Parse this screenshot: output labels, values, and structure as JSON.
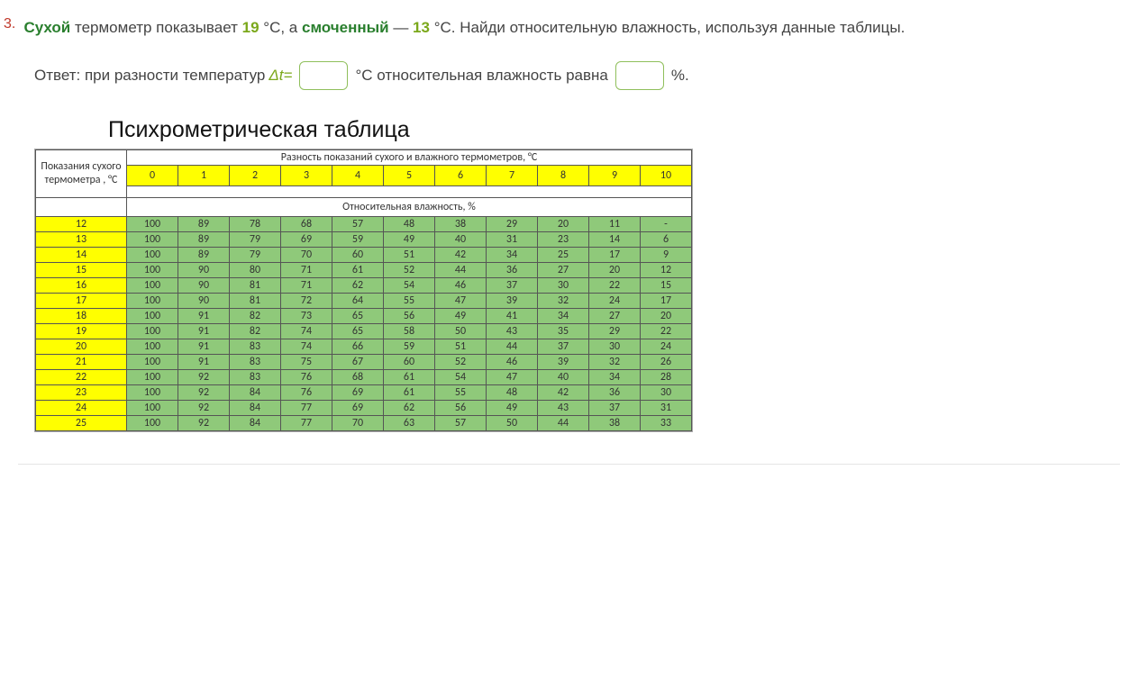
{
  "question": {
    "number": "3.",
    "t1": "Сухой",
    "t2": " термометр показывает ",
    "v1": "19",
    "t3": " °C, а ",
    "t4": "смоченный",
    "t5": " — ",
    "v2": "13",
    "t6": " °C. Найди относительную влажность, используя данные таблицы."
  },
  "answer": {
    "label1": "Ответ: при разности температур ",
    "delta": "Δt=",
    "label2": " °C относительная влажность равна ",
    "label3": " %."
  },
  "table": {
    "title": "Психрометрическая таблица",
    "left_header": "Показания сухого термометра , °C",
    "top_header": "Разность показаний сухого и влажного термометров, °C",
    "sub_header": "Относительная влажность, %",
    "cols": [
      "0",
      "1",
      "2",
      "3",
      "4",
      "5",
      "6",
      "7",
      "8",
      "9",
      "10"
    ],
    "rows": [
      {
        "t": "12",
        "v": [
          "100",
          "89",
          "78",
          "68",
          "57",
          "48",
          "38",
          "29",
          "20",
          "11",
          "-"
        ]
      },
      {
        "t": "13",
        "v": [
          "100",
          "89",
          "79",
          "69",
          "59",
          "49",
          "40",
          "31",
          "23",
          "14",
          "6"
        ]
      },
      {
        "t": "14",
        "v": [
          "100",
          "89",
          "79",
          "70",
          "60",
          "51",
          "42",
          "34",
          "25",
          "17",
          "9"
        ]
      },
      {
        "t": "15",
        "v": [
          "100",
          "90",
          "80",
          "71",
          "61",
          "52",
          "44",
          "36",
          "27",
          "20",
          "12"
        ]
      },
      {
        "t": "16",
        "v": [
          "100",
          "90",
          "81",
          "71",
          "62",
          "54",
          "46",
          "37",
          "30",
          "22",
          "15"
        ]
      },
      {
        "t": "17",
        "v": [
          "100",
          "90",
          "81",
          "72",
          "64",
          "55",
          "47",
          "39",
          "32",
          "24",
          "17"
        ]
      },
      {
        "t": "18",
        "v": [
          "100",
          "91",
          "82",
          "73",
          "65",
          "56",
          "49",
          "41",
          "34",
          "27",
          "20"
        ]
      },
      {
        "t": "19",
        "v": [
          "100",
          "91",
          "82",
          "74",
          "65",
          "58",
          "50",
          "43",
          "35",
          "29",
          "22"
        ]
      },
      {
        "t": "20",
        "v": [
          "100",
          "91",
          "83",
          "74",
          "66",
          "59",
          "51",
          "44",
          "37",
          "30",
          "24"
        ]
      },
      {
        "t": "21",
        "v": [
          "100",
          "91",
          "83",
          "75",
          "67",
          "60",
          "52",
          "46",
          "39",
          "32",
          "26"
        ]
      },
      {
        "t": "22",
        "v": [
          "100",
          "92",
          "83",
          "76",
          "68",
          "61",
          "54",
          "47",
          "40",
          "34",
          "28"
        ]
      },
      {
        "t": "23",
        "v": [
          "100",
          "92",
          "84",
          "76",
          "69",
          "61",
          "55",
          "48",
          "42",
          "36",
          "30"
        ]
      },
      {
        "t": "24",
        "v": [
          "100",
          "92",
          "84",
          "77",
          "69",
          "62",
          "56",
          "49",
          "43",
          "37",
          "31"
        ]
      },
      {
        "t": "25",
        "v": [
          "100",
          "92",
          "84",
          "77",
          "70",
          "63",
          "57",
          "50",
          "44",
          "38",
          "33"
        ]
      }
    ]
  },
  "chart_data": {
    "type": "table",
    "title": "Психрометрическая таблица",
    "xlabel": "Разность показаний сухого и влажного термометров, °C",
    "ylabel": "Показания сухого термометра, °C",
    "value_label": "Относительная влажность, %",
    "x": [
      0,
      1,
      2,
      3,
      4,
      5,
      6,
      7,
      8,
      9,
      10
    ],
    "y": [
      12,
      13,
      14,
      15,
      16,
      17,
      18,
      19,
      20,
      21,
      22,
      23,
      24,
      25
    ],
    "values": [
      [
        100,
        89,
        78,
        68,
        57,
        48,
        38,
        29,
        20,
        11,
        null
      ],
      [
        100,
        89,
        79,
        69,
        59,
        49,
        40,
        31,
        23,
        14,
        6
      ],
      [
        100,
        89,
        79,
        70,
        60,
        51,
        42,
        34,
        25,
        17,
        9
      ],
      [
        100,
        90,
        80,
        71,
        61,
        52,
        44,
        36,
        27,
        20,
        12
      ],
      [
        100,
        90,
        81,
        71,
        62,
        54,
        46,
        37,
        30,
        22,
        15
      ],
      [
        100,
        90,
        81,
        72,
        64,
        55,
        47,
        39,
        32,
        24,
        17
      ],
      [
        100,
        91,
        82,
        73,
        65,
        56,
        49,
        41,
        34,
        27,
        20
      ],
      [
        100,
        91,
        82,
        74,
        65,
        58,
        50,
        43,
        35,
        29,
        22
      ],
      [
        100,
        91,
        83,
        74,
        66,
        59,
        51,
        44,
        37,
        30,
        24
      ],
      [
        100,
        91,
        83,
        75,
        67,
        60,
        52,
        46,
        39,
        32,
        26
      ],
      [
        100,
        92,
        83,
        76,
        68,
        61,
        54,
        47,
        40,
        34,
        28
      ],
      [
        100,
        92,
        84,
        76,
        69,
        61,
        55,
        48,
        42,
        36,
        30
      ],
      [
        100,
        92,
        84,
        77,
        69,
        62,
        56,
        49,
        43,
        37,
        31
      ],
      [
        100,
        92,
        84,
        77,
        70,
        63,
        57,
        50,
        44,
        38,
        33
      ]
    ]
  }
}
